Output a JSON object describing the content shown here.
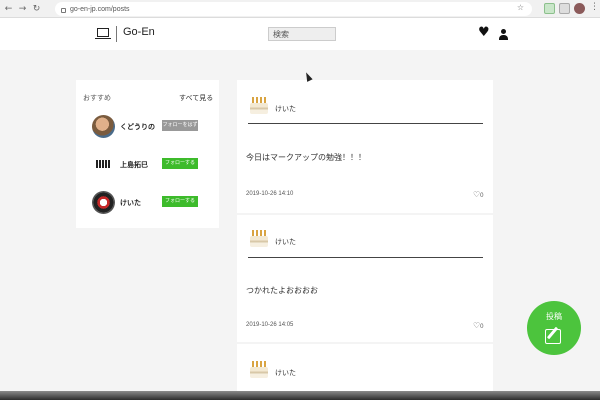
{
  "browser": {
    "url": "go-en-jp.com/posts",
    "back_icon": "arrow-left-icon",
    "forward_icon": "arrow-right-icon",
    "reload_icon": "reload-icon",
    "lock_icon": "lock-icon",
    "bookmark_icon": "star-icon",
    "menu_icon": "dots-vertical-icon"
  },
  "header": {
    "logo_icon": "laptop-icon",
    "logo_text": "Go-En",
    "search_placeholder": "検索",
    "favorites_icon": "heart-icon",
    "profile_icon": "user-icon"
  },
  "recommend": {
    "title": "おすすめ",
    "see_all": "すべて見る",
    "users": [
      {
        "name": "くどうりの",
        "button": "フォローをはずす",
        "following": true
      },
      {
        "name": "上島拓巳",
        "button": "フォローする",
        "following": false
      },
      {
        "name": "けいた",
        "button": "フォローする",
        "following": false
      }
    ]
  },
  "posts": [
    {
      "user": "けいた",
      "text": "今日はマークアップの勉強！！！",
      "date": "2019-10-26 14:10",
      "likes": "0"
    },
    {
      "user": "けいた",
      "text": "つかれたよおおおお",
      "date": "2019-10-26 14:05",
      "likes": "0"
    },
    {
      "user": "けいた",
      "text": "",
      "date": "",
      "likes": ""
    }
  ],
  "fab": {
    "label": "投稿",
    "icon": "edit-icon"
  },
  "colors": {
    "accent": "#3dbb2b",
    "unfollow": "#999999",
    "background": "#f4f4f4"
  }
}
